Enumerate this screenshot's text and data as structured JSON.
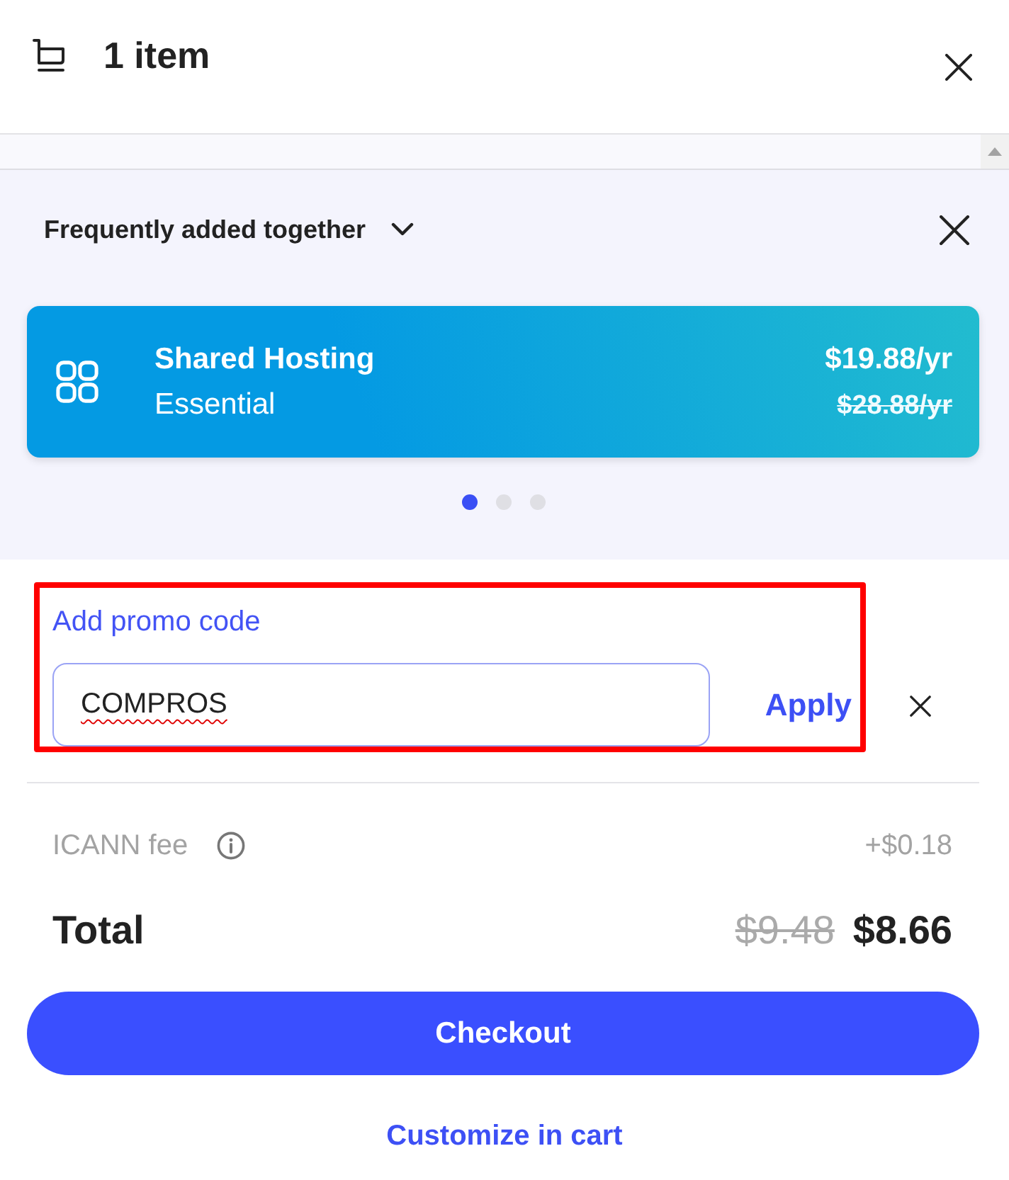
{
  "header": {
    "title": "1 item"
  },
  "upsell": {
    "title": "Frequently added together",
    "products": [
      {
        "name": "Shared Hosting",
        "plan": "Essential",
        "price": "$19.88/yr",
        "old_price": "$28.88/yr"
      }
    ],
    "pages": [
      {
        "selected": true
      },
      {
        "selected": false
      },
      {
        "selected": false
      }
    ]
  },
  "promo": {
    "highlighted": true,
    "link": "Add promo code",
    "value": "COMPROS",
    "misspelled": true,
    "apply": "Apply"
  },
  "fees": [
    {
      "label": "ICANN fee",
      "amount": "+$0.18"
    }
  ],
  "total": {
    "label": "Total",
    "old_amount": "$9.48",
    "amount": "$8.66"
  },
  "checkout": "Checkout",
  "customize": "Customize in cart"
}
